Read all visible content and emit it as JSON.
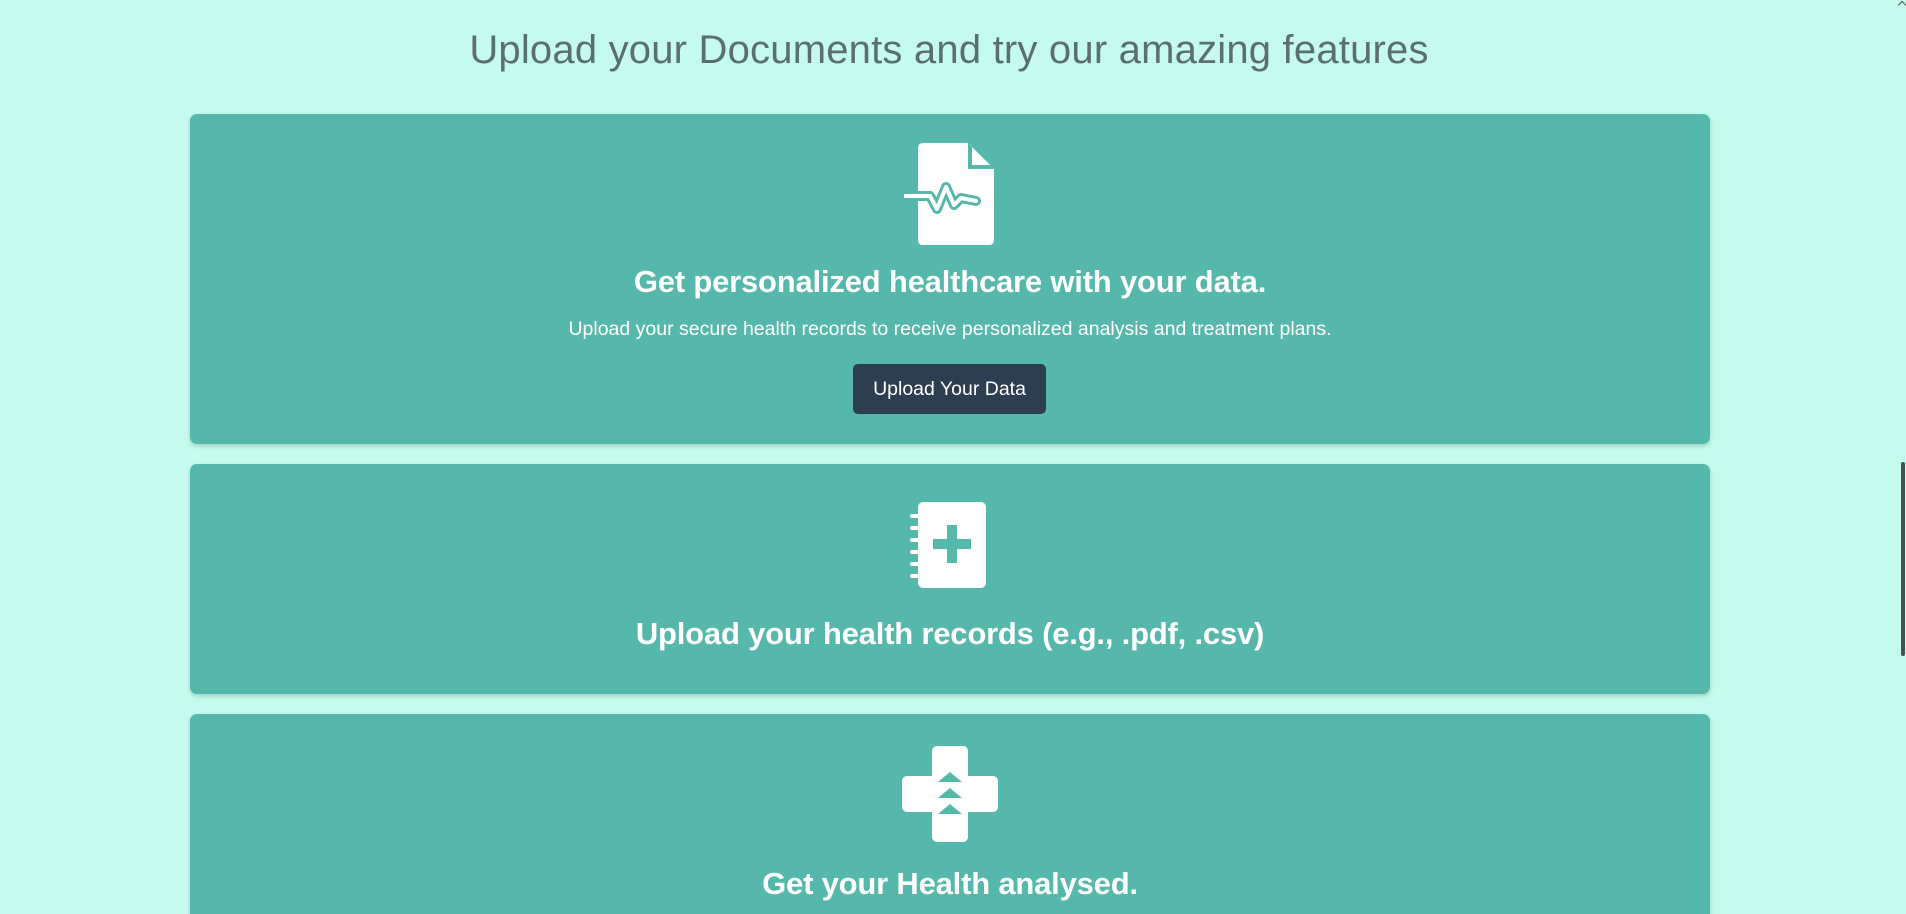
{
  "section": {
    "title": "Upload your Documents and try our amazing features"
  },
  "cards": [
    {
      "icon": "file-medical-pulse-icon",
      "heading": "Get personalized healthcare with your data.",
      "text": "Upload your secure health records to receive personalized analysis and treatment plans.",
      "button_label": "Upload Your Data"
    },
    {
      "icon": "medical-notebook-icon",
      "heading": "Upload your health records (e.g., .pdf, .csv)"
    },
    {
      "icon": "medical-cross-arrows-icon",
      "heading": "Get your Health analysed."
    }
  ],
  "colors": {
    "background": "#c5fbee",
    "card": "#55b8aa",
    "button": "#2c3e4f",
    "title_text": "#5a6f73"
  }
}
